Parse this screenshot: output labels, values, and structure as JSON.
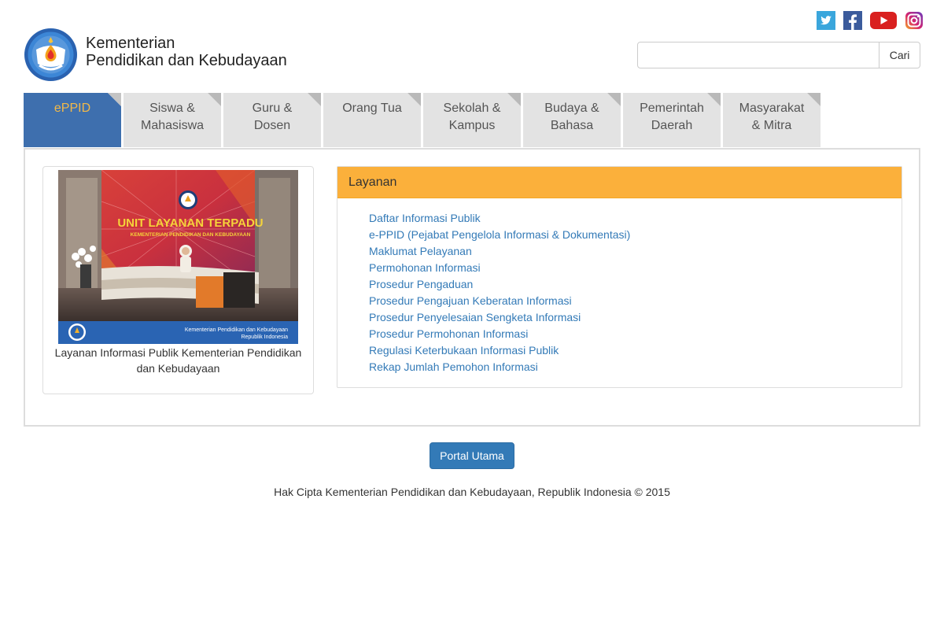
{
  "header": {
    "brand_line1": "Kementerian",
    "brand_line2": "Pendidikan dan Kebudayaan"
  },
  "social": [
    "twitter-icon",
    "facebook-icon",
    "youtube-icon",
    "instagram-icon"
  ],
  "search": {
    "placeholder": "",
    "value": "",
    "button_label": "Cari"
  },
  "tabs": [
    {
      "label": "ePPID",
      "active": true
    },
    {
      "label": "Siswa & Mahasiswa"
    },
    {
      "label": "Guru & Dosen"
    },
    {
      "label": "Orang Tua"
    },
    {
      "label": "Sekolah & Kampus"
    },
    {
      "label": "Budaya & Bahasa"
    },
    {
      "label": "Pemerintah Daerah"
    },
    {
      "label": "Masyarakat & Mitra"
    }
  ],
  "thumbnail": {
    "caption": "Layanan Informasi Publik Kementerian Pendidikan dan Kebudayaan",
    "photo_sign_title": "UNIT LAYANAN TERPADU",
    "photo_sign_subtitle": "KEMENTERIAN PENDIDIKAN DAN KEBUDAYAAN",
    "photo_banner_line1": "Kementerian Pendidikan dan Kebudayaan",
    "photo_banner_line2": "Republik Indonesia"
  },
  "panel": {
    "title": "Layanan",
    "links": [
      "Daftar Informasi Publik",
      "e-PPID (Pejabat Pengelola Informasi & Dokumentasi)",
      "Maklumat Pelayanan",
      "Permohonan Informasi",
      "Prosedur Pengaduan",
      "Prosedur Pengajuan Keberatan Informasi",
      "Prosedur Penyelesaian Sengketa Informasi",
      "Prosedur Permohonan Informasi",
      "Regulasi Keterbukaan Informasi Publik",
      "Rekap Jumlah Pemohon Informasi"
    ]
  },
  "footer": {
    "portal_button": "Portal Utama",
    "copyright": "Hak Cipta Kementerian Pendidikan dan Kebudayaan, Republik Indonesia © 2015"
  },
  "colors": {
    "tab_active_bg": "#3e6fae",
    "tab_active_text": "#f3b948",
    "panel_header": "#fbb03b",
    "link": "#337ab7",
    "primary_button": "#337ab7"
  }
}
